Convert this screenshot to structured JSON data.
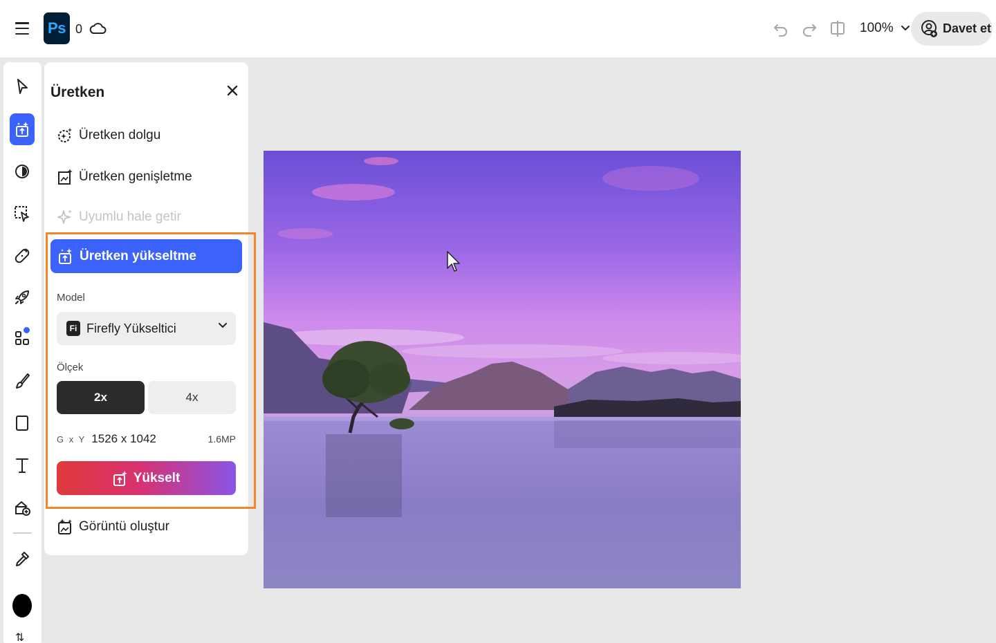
{
  "header": {
    "app_logo": "Ps",
    "cloud_count": "0",
    "zoom_level": "100%",
    "invite_label": "Davet et",
    "icons": [
      "menu-icon",
      "cloud-icon",
      "undo-icon",
      "redo-icon",
      "compare-icon",
      "chevron-down-icon",
      "invite-user-icon"
    ]
  },
  "toolbar": {
    "tools": [
      "select-tool",
      "generative-tool",
      "adjust-tool",
      "selection-tool",
      "heal-tool",
      "quick-actions-tool",
      "add-ons-tool",
      "brush-tool",
      "shape-tool",
      "text-tool",
      "add-image-tool",
      "eyedropper-tool"
    ],
    "active_tool": "generative-tool",
    "foreground_color": "#000000"
  },
  "panel": {
    "title": "Üretken",
    "items": [
      {
        "label": "Üretken dolgu",
        "enabled": true
      },
      {
        "label": "Üretken genişletme",
        "enabled": true
      },
      {
        "label": "Uyumlu hale getir",
        "enabled": false
      },
      {
        "label": "Üretken yükseltme",
        "enabled": true,
        "selected": true
      },
      {
        "label": "Görüntü oluştur",
        "enabled": true
      }
    ],
    "upscale": {
      "model_label": "Model",
      "model_badge": "Fi",
      "model_value": "Firefly Yükseltici",
      "scale_label": "Ölçek",
      "scale_options": [
        "2x",
        "4x"
      ],
      "scale_selected": "2x",
      "dims_prefix": "G x Y",
      "dims_value": "1526 x 1042",
      "megapixels": "1.6MP",
      "action_label": "Yükselt"
    }
  },
  "colors": {
    "accent_blue": "#3b63fb",
    "highlight_orange": "#f3862b",
    "gradient_start": "#e03a3a",
    "gradient_end": "#8a55e8"
  }
}
